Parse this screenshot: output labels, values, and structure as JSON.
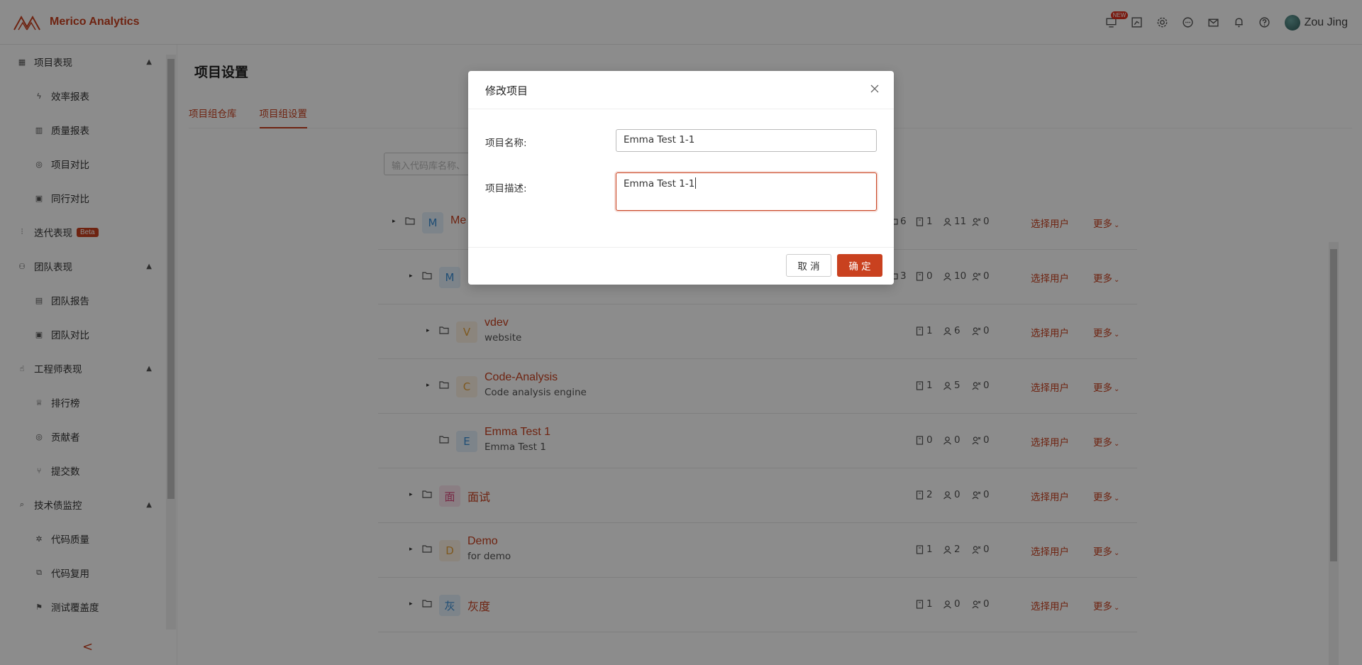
{
  "header": {
    "brand": "Merico Analytics",
    "new_badge": "NEW",
    "user_name": "Zou Jing",
    "brand_color": "#c9411f"
  },
  "sidebar": {
    "items": [
      {
        "label": "项目表现",
        "type": "group",
        "icon": "chart-board-icon",
        "caret": "▲"
      },
      {
        "label": "效率报表",
        "type": "sub",
        "icon": "bolt-icon"
      },
      {
        "label": "质量报表",
        "type": "sub",
        "icon": "bar-chart-icon"
      },
      {
        "label": "项目对比",
        "type": "sub",
        "icon": "compare-circle-icon"
      },
      {
        "label": "同行对比",
        "type": "sub",
        "icon": "peer-compare-icon"
      },
      {
        "label": "迭代表现",
        "type": "group",
        "icon": "iteration-icon",
        "badge": "Beta"
      },
      {
        "label": "团队表现",
        "type": "group",
        "icon": "team-icon",
        "caret": "▲"
      },
      {
        "label": "团队报告",
        "type": "sub",
        "icon": "report-icon"
      },
      {
        "label": "团队对比",
        "type": "sub",
        "icon": "team-compare-icon"
      },
      {
        "label": "工程师表现",
        "type": "group",
        "icon": "thumb-up-icon",
        "caret": "▲"
      },
      {
        "label": "排行榜",
        "type": "sub",
        "icon": "trophy-icon"
      },
      {
        "label": "贡献者",
        "type": "sub",
        "icon": "contributor-icon"
      },
      {
        "label": "提交数",
        "type": "sub",
        "icon": "branch-icon"
      },
      {
        "label": "技术债监控",
        "type": "group",
        "icon": "monitor-search-icon",
        "caret": "▲"
      },
      {
        "label": "代码质量",
        "type": "sub",
        "icon": "bug-icon"
      },
      {
        "label": "代码复用",
        "type": "sub",
        "icon": "copy-icon"
      },
      {
        "label": "测试覆盖度",
        "type": "sub",
        "icon": "flag-icon"
      }
    ],
    "collapse_glyph": "<"
  },
  "main": {
    "title": "项目设置",
    "tabs": [
      {
        "label": "项目组仓库",
        "active": false
      },
      {
        "label": "项目组设置",
        "active": true
      }
    ],
    "search_placeholder": "输入代码库名称、",
    "rows": [
      {
        "letter": "M",
        "name": "Me",
        "desc": "",
        "level": 0,
        "caret": true,
        "stats": [
          "6",
          "1",
          "11",
          "0"
        ],
        "letter_color": "#3b8fd6",
        "letter_bg": "#e3f0fb"
      },
      {
        "letter": "M",
        "name": "",
        "desc": "",
        "level": 1,
        "caret": true,
        "stats": [
          "3",
          "0",
          "10",
          "0"
        ],
        "letter_color": "#3b8fd6",
        "letter_bg": "#e3f0fb"
      },
      {
        "letter": "V",
        "name": "vdev",
        "desc": "website",
        "level": 2,
        "caret": true,
        "stats": [
          "",
          "1",
          "6",
          "0"
        ],
        "letter_color": "#e6a23c",
        "letter_bg": "#fdf3e3"
      },
      {
        "letter": "C",
        "name": "Code-Analysis",
        "desc": "Code analysis engine",
        "level": 2,
        "caret": true,
        "stats": [
          "",
          "1",
          "5",
          "0"
        ],
        "letter_color": "#e6a23c",
        "letter_bg": "#fdf3e3"
      },
      {
        "letter": "E",
        "name": "Emma Test 1",
        "desc": "Emma Test 1",
        "level": 2,
        "caret": false,
        "stats": [
          "",
          "0",
          "0",
          "0"
        ],
        "letter_color": "#3b8fd6",
        "letter_bg": "#e3f0fb"
      },
      {
        "letter": "面",
        "name": "面试",
        "desc": "",
        "level": 1,
        "caret": true,
        "stats": [
          "",
          "2",
          "0",
          "0"
        ],
        "letter_color": "#d9457a",
        "letter_bg": "#fce6ee"
      },
      {
        "letter": "D",
        "name": "Demo",
        "desc": "for demo",
        "level": 1,
        "caret": true,
        "stats": [
          "",
          "1",
          "2",
          "0"
        ],
        "letter_color": "#e6a23c",
        "letter_bg": "#fdf3e3"
      },
      {
        "letter": "灰",
        "name": "灰度",
        "desc": "",
        "level": 1,
        "caret": true,
        "stats": [
          "",
          "1",
          "0",
          "0"
        ],
        "letter_color": "#3b8fd6",
        "letter_bg": "#e3f0fb"
      }
    ],
    "select_user_label": "选择用户",
    "more_label": "更多"
  },
  "modal": {
    "title": "修改项目",
    "name_label": "项目名称:",
    "name_value": "Emma Test 1-1",
    "desc_label": "项目描述:",
    "desc_value": "Emma Test 1-1",
    "cancel_label": "取 消",
    "ok_label": "确 定"
  }
}
